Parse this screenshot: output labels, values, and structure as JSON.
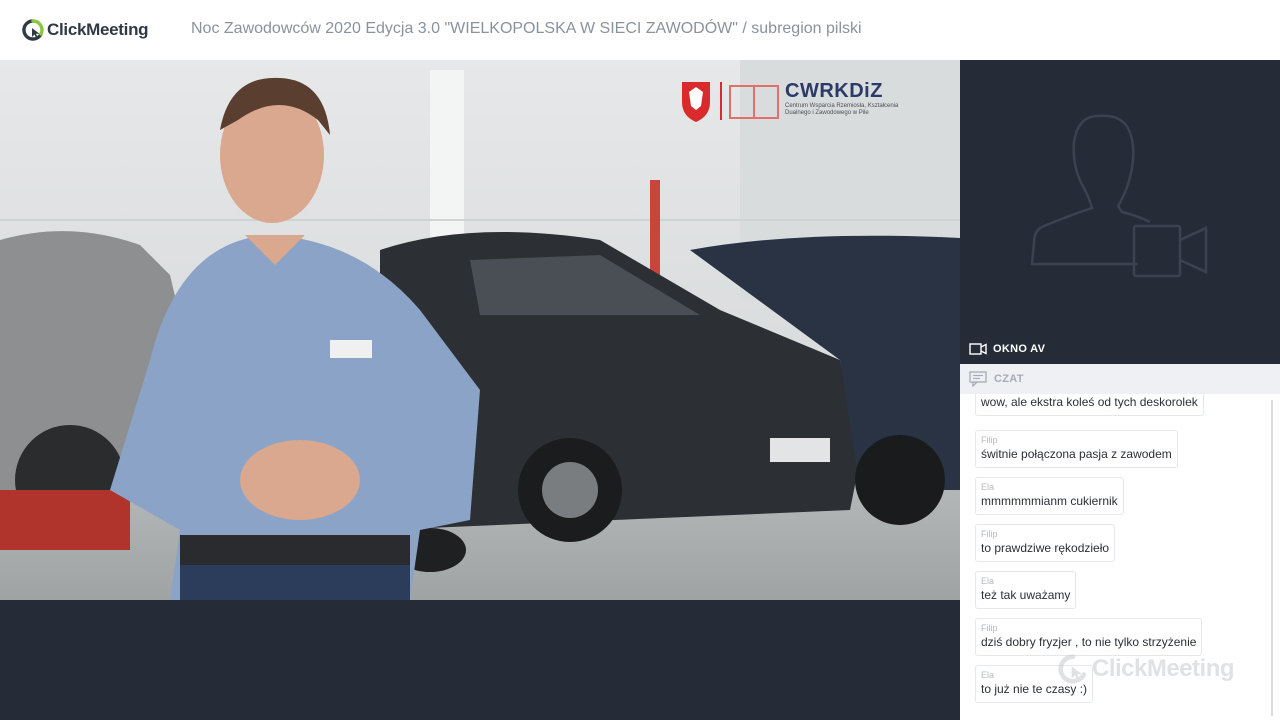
{
  "header": {
    "brand": "ClickMeeting",
    "event_title": "Noc Zawodowców 2020 Edycja 3.0 \"WIELKOPOLSKA W SIECI ZAWODÓW\" / subregion pilski"
  },
  "video": {
    "overlay_logo_text": "CWRKDiZ",
    "overlay_logo_subtitle_1": "Centrum Wsparcia Rzemiosła, Kształcenia",
    "overlay_logo_subtitle_2": "Dualnego i Zawodowego w Pile"
  },
  "sidebar": {
    "av_label": "OKNO AV",
    "chat_label": "CZAT"
  },
  "chat": {
    "messages": [
      {
        "author": "",
        "text": "wow, ale ekstra koleś od tych deskorolek"
      },
      {
        "author": "Filip",
        "text": "świtnie połączona pasja z zawodem"
      },
      {
        "author": "Ela",
        "text": "mmmmmmianm cukiernik"
      },
      {
        "author": "Filip",
        "text": "to prawdziwe rękodzieło"
      },
      {
        "author": "Ela",
        "text": "też tak uważamy"
      },
      {
        "author": "Filip",
        "text": "dziś dobry fryzjer , to nie tylko strzyżenie"
      },
      {
        "author": "Ela",
        "text": "to już nie te czasy :)"
      }
    ]
  },
  "watermark": {
    "text": "ClickMeeting"
  },
  "colors": {
    "dark_panel": "#262c37",
    "brand_green": "#8cc63f",
    "brand_dark": "#2f3a45"
  }
}
